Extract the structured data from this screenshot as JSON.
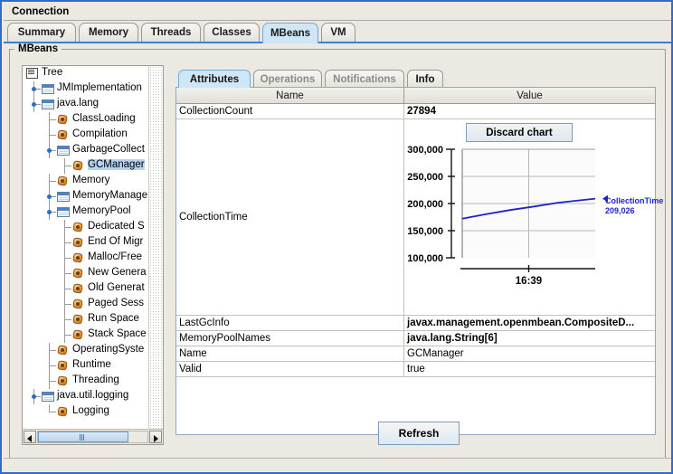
{
  "window": {
    "menu": {
      "connection_label": "Connection"
    },
    "tabs": [
      {
        "label": "Summary",
        "selected": false
      },
      {
        "label": "Memory",
        "selected": false
      },
      {
        "label": "Threads",
        "selected": false
      },
      {
        "label": "Classes",
        "selected": false
      },
      {
        "label": "MBeans",
        "selected": true
      },
      {
        "label": "VM",
        "selected": false
      }
    ],
    "panel_title": "MBeans",
    "refresh_label": "Refresh"
  },
  "tree": {
    "root_label": "Tree",
    "nodes": [
      {
        "label": "Tree",
        "depth": 0,
        "icon": "tree-icon",
        "handle": "none",
        "selected": false
      },
      {
        "label": "JMImplementation",
        "depth": 1,
        "icon": "folder-icon",
        "handle": "collapsed",
        "selected": false
      },
      {
        "label": "java.lang",
        "depth": 1,
        "icon": "folder-icon",
        "handle": "expanded",
        "selected": false
      },
      {
        "label": "ClassLoading",
        "depth": 2,
        "icon": "mbean-icon",
        "handle": "none",
        "selected": false
      },
      {
        "label": "Compilation",
        "depth": 2,
        "icon": "mbean-icon",
        "handle": "none",
        "selected": false
      },
      {
        "label": "GarbageCollect",
        "depth": 2,
        "icon": "folder-icon",
        "handle": "expanded",
        "selected": false
      },
      {
        "label": "GCManager",
        "depth": 3,
        "icon": "mbean-icon",
        "handle": "none",
        "selected": true
      },
      {
        "label": "Memory",
        "depth": 2,
        "icon": "mbean-icon",
        "handle": "none",
        "selected": false
      },
      {
        "label": "MemoryManage",
        "depth": 2,
        "icon": "folder-icon",
        "handle": "collapsed",
        "selected": false
      },
      {
        "label": "MemoryPool",
        "depth": 2,
        "icon": "folder-icon",
        "handle": "expanded",
        "selected": false
      },
      {
        "label": "Dedicated S",
        "depth": 3,
        "icon": "mbean-icon",
        "handle": "none",
        "selected": false
      },
      {
        "label": "End Of Migr",
        "depth": 3,
        "icon": "mbean-icon",
        "handle": "none",
        "selected": false
      },
      {
        "label": "Malloc/Free",
        "depth": 3,
        "icon": "mbean-icon",
        "handle": "none",
        "selected": false
      },
      {
        "label": "New Genera",
        "depth": 3,
        "icon": "mbean-icon",
        "handle": "none",
        "selected": false
      },
      {
        "label": "Old Generat",
        "depth": 3,
        "icon": "mbean-icon",
        "handle": "none",
        "selected": false
      },
      {
        "label": "Paged Sess",
        "depth": 3,
        "icon": "mbean-icon",
        "handle": "none",
        "selected": false
      },
      {
        "label": "Run Space",
        "depth": 3,
        "icon": "mbean-icon",
        "handle": "none",
        "selected": false
      },
      {
        "label": "Stack Space",
        "depth": 3,
        "icon": "mbean-icon",
        "handle": "none",
        "selected": false
      },
      {
        "label": "OperatingSyste",
        "depth": 2,
        "icon": "mbean-icon",
        "handle": "none",
        "selected": false
      },
      {
        "label": "Runtime",
        "depth": 2,
        "icon": "mbean-icon",
        "handle": "none",
        "selected": false
      },
      {
        "label": "Threading",
        "depth": 2,
        "icon": "mbean-icon",
        "handle": "none",
        "selected": false
      },
      {
        "label": "java.util.logging",
        "depth": 1,
        "icon": "folder-icon",
        "handle": "expanded",
        "selected": false
      },
      {
        "label": "Logging",
        "depth": 2,
        "icon": "mbean-icon",
        "handle": "none",
        "selected": false
      }
    ]
  },
  "detail": {
    "tabs": [
      {
        "label": "Attributes",
        "selected": true,
        "disabled": false
      },
      {
        "label": "Operations",
        "selected": false,
        "disabled": true
      },
      {
        "label": "Notifications",
        "selected": false,
        "disabled": true
      },
      {
        "label": "Info",
        "selected": false,
        "disabled": false
      }
    ],
    "table": {
      "headers": [
        "Name",
        "Value"
      ],
      "rows": [
        {
          "name": "CollectionCount",
          "value": "27894",
          "bold": true,
          "chart": false
        },
        {
          "name": "CollectionTime",
          "value": "",
          "bold": false,
          "chart": true
        },
        {
          "name": "LastGcInfo",
          "value": "javax.management.openmbean.CompositeD...",
          "bold": true,
          "chart": false
        },
        {
          "name": "MemoryPoolNames",
          "value": "java.lang.String[6]",
          "bold": true,
          "chart": false
        },
        {
          "name": "Name",
          "value": "GCManager",
          "bold": false,
          "chart": false
        },
        {
          "name": "Valid",
          "value": "true",
          "bold": false,
          "chart": false
        }
      ]
    },
    "chart_controls": {
      "discard_label": "Discard chart"
    }
  },
  "chart_data": {
    "type": "line",
    "title": "",
    "xlabel": "",
    "ylabel": "",
    "series": [
      {
        "name": "CollectionTime",
        "color": "#1d23c8",
        "current_value_label": "209,026",
        "current_value": 209026,
        "x": [
          0,
          0.18,
          0.36,
          0.54,
          0.72,
          1.0
        ],
        "values": [
          172000,
          180500,
          188000,
          194500,
          201500,
          209026
        ]
      }
    ],
    "ytick_labels": [
      "300,000",
      "250,000",
      "200,000",
      "150,000",
      "100,000"
    ],
    "yticks": [
      300000,
      250000,
      200000,
      150000,
      100000
    ],
    "ylim": [
      100000,
      300000
    ],
    "xtick_labels": [
      "16:39"
    ],
    "grid": true,
    "legend_position": "right"
  }
}
